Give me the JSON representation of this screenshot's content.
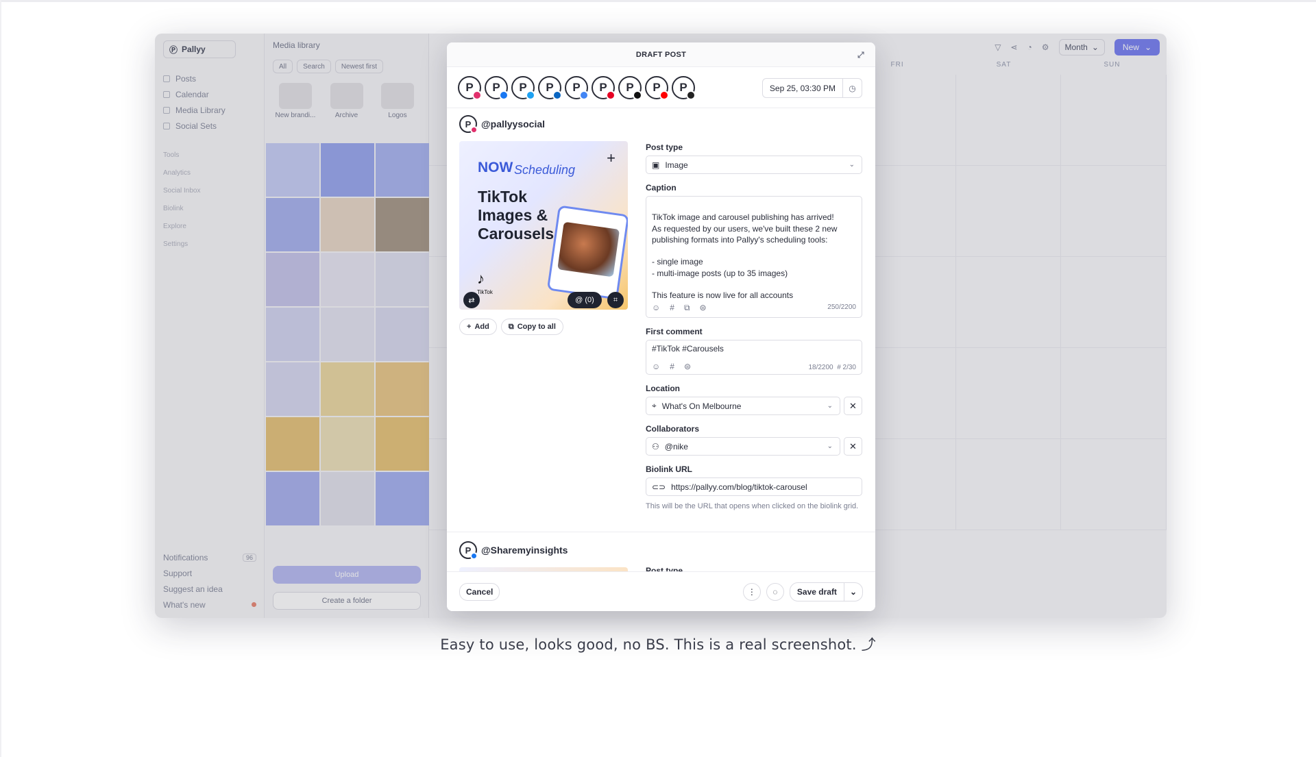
{
  "app": {
    "brand": "Pallyy",
    "nav": [
      "Posts",
      "Calendar",
      "Media Library",
      "Social Sets"
    ],
    "tools": [
      "Tools",
      "Analytics",
      "Social Inbox",
      "Biolink",
      "Explore",
      "Settings"
    ],
    "bottom": {
      "notifications": "Notifications",
      "notifications_count": "96",
      "support": "Support",
      "suggest": "Suggest an idea",
      "whats_new": "What's new"
    }
  },
  "media": {
    "title": "Media library",
    "filters": [
      "All",
      "Search",
      "Newest first"
    ],
    "folders": [
      "New brandi...",
      "Archive",
      "Logos"
    ],
    "upload": "Upload",
    "create_folder": "Create a folder"
  },
  "calendar": {
    "view": "Month",
    "new_label": "New",
    "days": [
      "FRI",
      "SAT",
      "SUN"
    ]
  },
  "modal": {
    "title": "DRAFT POST",
    "date": "Sep 25, 03:30 PM",
    "accounts_networks": [
      "instagram",
      "facebook",
      "twitter",
      "linkedin",
      "google",
      "pinterest",
      "tiktok",
      "youtube",
      "threads"
    ],
    "account1": "@pallyysocial",
    "account2": "@Sharemyinsights",
    "preview": {
      "now": "NOW",
      "scheduling": "Scheduling",
      "title": "TikTok Images & Carousels",
      "tiktok": "TikTok",
      "mentions": "@ (0)"
    },
    "add": "Add",
    "copy_to_all": "Copy to all",
    "post_type_label": "Post type",
    "post_type": "Image",
    "caption_label": "Caption",
    "caption": "TikTok image and carousel publishing has arrived!\nAs requested by our users, we've built these 2 new publishing formats into Pallyy's scheduling tools:\n\n- single image\n- multi-image posts (up to 35 images)\n\nThis feature is now live for all accounts",
    "caption_count": "250/2200",
    "first_comment_label": "First comment",
    "first_comment": "#TikTok #Carousels",
    "first_comment_count": "18/2200",
    "hashtag_count": "# 2/30",
    "location_label": "Location",
    "location": "What's On Melbourne",
    "collaborators_label": "Collaborators",
    "collaborators": "@nike",
    "biolink_label": "Biolink URL",
    "biolink": "https://pallyy.com/blog/tiktok-carousel",
    "biolink_hint": "This will be the URL that opens when clicked on the biolink grid.",
    "post_type_label_2": "Post type",
    "cancel": "Cancel",
    "save_draft": "Save draft"
  },
  "tagline": "Easy to use, looks good, no BS. This is a real screenshot. ⤴"
}
